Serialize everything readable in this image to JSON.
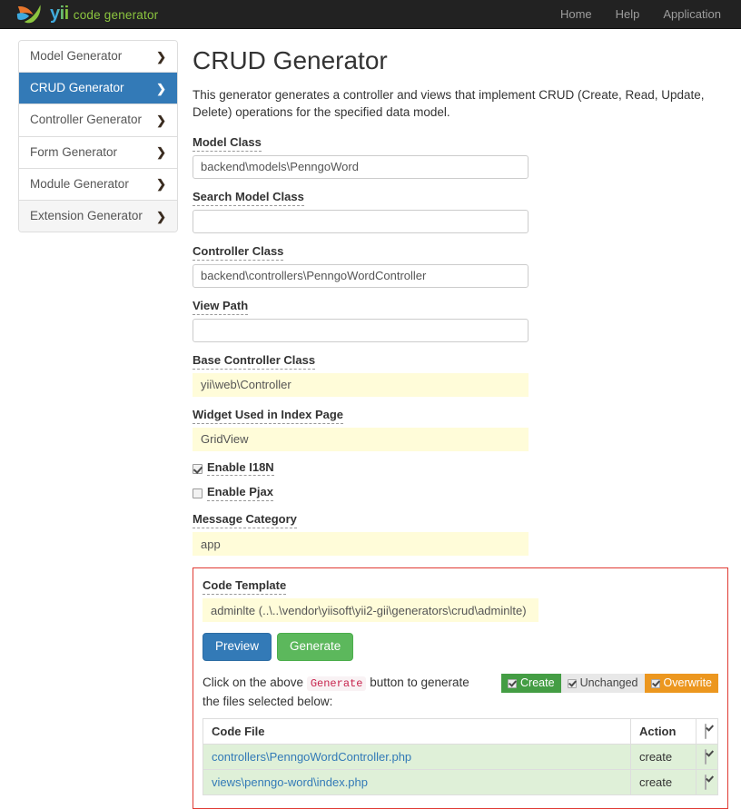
{
  "navbar": {
    "brand_name": "yii",
    "brand_subtitle": "code generator",
    "links": [
      {
        "label": "Home"
      },
      {
        "label": "Help"
      },
      {
        "label": "Application"
      }
    ]
  },
  "sidebar": {
    "items": [
      {
        "label": "Model Generator",
        "state": "normal"
      },
      {
        "label": "CRUD Generator",
        "state": "active"
      },
      {
        "label": "Controller Generator",
        "state": "normal"
      },
      {
        "label": "Form Generator",
        "state": "normal"
      },
      {
        "label": "Module Generator",
        "state": "normal"
      },
      {
        "label": "Extension Generator",
        "state": "muted"
      }
    ],
    "chevron": "❯"
  },
  "main": {
    "title": "CRUD Generator",
    "description": "This generator generates a controller and views that implement CRUD (Create, Read, Update, Delete) operations for the specified data model.",
    "fields": [
      {
        "label": "Model Class",
        "value": "backend\\models\\PenngoWord",
        "style": "normal"
      },
      {
        "label": "Search Model Class",
        "value": "",
        "style": "normal"
      },
      {
        "label": "Controller Class",
        "value": "backend\\controllers\\PenngoWordController",
        "style": "normal"
      },
      {
        "label": "View Path",
        "value": "",
        "style": "normal"
      },
      {
        "label": "Base Controller Class",
        "value": "yii\\web\\Controller",
        "style": "autofill"
      },
      {
        "label": "Widget Used in Index Page",
        "value": "GridView",
        "style": "autofill"
      }
    ],
    "checkboxes": [
      {
        "label": "Enable I18N",
        "checked": true
      },
      {
        "label": "Enable Pjax",
        "checked": false
      }
    ],
    "message_category": {
      "label": "Message Category",
      "value": "app",
      "style": "autofill"
    }
  },
  "template_panel": {
    "code_template": {
      "label": "Code Template",
      "value": "adminlte (..\\..\\vendor\\yiisoft\\yii2-gii\\generators\\crud\\adminlte)"
    },
    "buttons": {
      "preview": "Preview",
      "generate": "Generate"
    },
    "hint_prefix": "Click on the above ",
    "hint_code": "Generate",
    "hint_suffix": " button to generate the files selected below:",
    "legend": [
      {
        "label": "Create",
        "color": "#449d44",
        "checked": true
      },
      {
        "label": "Unchanged",
        "color": "#e8e8e8",
        "checked": true
      },
      {
        "label": "Overwrite",
        "color": "#ec971f",
        "checked": true
      }
    ],
    "table": {
      "headers": {
        "code_file": "Code File",
        "action": "Action"
      },
      "header_checkbox": true,
      "rows": [
        {
          "file": "controllers\\PenngoWordController.php",
          "action": "create",
          "checked": true,
          "state": "create"
        },
        {
          "file": "views\\penngo-word\\index.php",
          "action": "create",
          "checked": true,
          "state": "create"
        }
      ]
    }
  },
  "colors": {
    "navbar_bg": "#222222",
    "active_sidebar": "#337ab7",
    "panel_border": "#e03a33",
    "autofill_bg": "#fffcd9",
    "row_create_bg": "#dff0d8",
    "brand_green": "#8cc63f"
  }
}
